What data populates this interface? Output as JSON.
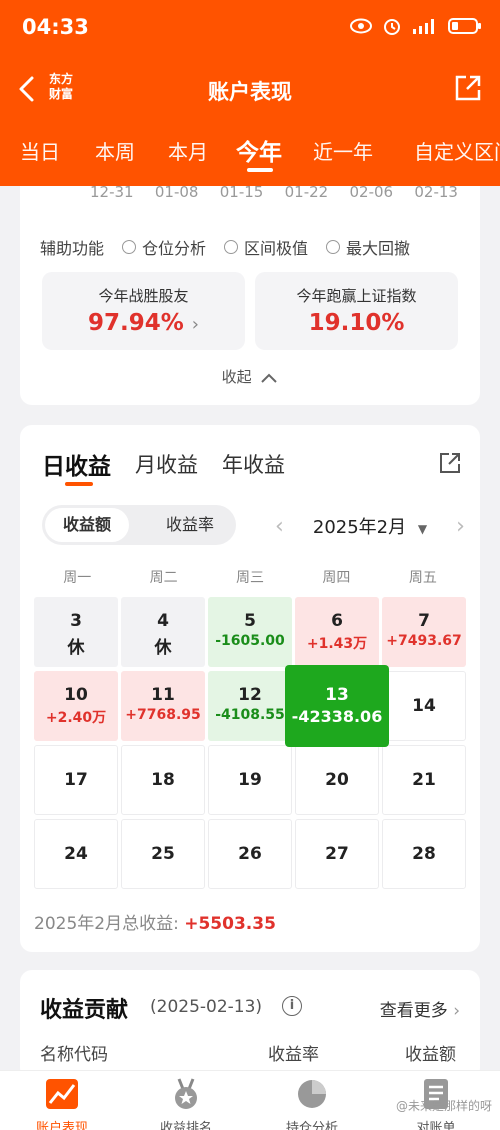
{
  "status": {
    "time": "04:33"
  },
  "header": {
    "logo": "东方\n财富",
    "title": "账户表现"
  },
  "period_tabs": [
    {
      "label": "当日",
      "active": false
    },
    {
      "label": "本周",
      "active": false
    },
    {
      "label": "本月",
      "active": false
    },
    {
      "label": "今年",
      "active": true
    },
    {
      "label": "近一年",
      "active": false
    },
    {
      "label": "自定义区间",
      "active": false
    }
  ],
  "chart_dates": [
    "12-31",
    "01-08",
    "01-15",
    "01-22",
    "02-06",
    "02-13"
  ],
  "aux": {
    "label": "辅助功能",
    "options": [
      "仓位分析",
      "区间极值",
      "最大回撤"
    ]
  },
  "stats": {
    "beat_label": "今年战胜股友",
    "beat_value": "97.94%",
    "index_label": "今年跑赢上证指数",
    "index_value": "19.10%"
  },
  "collapse_label": "收起",
  "profit": {
    "tabs": [
      "日收益",
      "月收益",
      "年收益"
    ],
    "segments": [
      "收益额",
      "收益率"
    ],
    "month": "2025年2月",
    "weekdays": [
      "周一",
      "周二",
      "周三",
      "周四",
      "周五"
    ],
    "days": [
      {
        "day": "3",
        "value": "休",
        "kind": "rest"
      },
      {
        "day": "4",
        "value": "休",
        "kind": "rest"
      },
      {
        "day": "5",
        "value": "-1605.00",
        "kind": "neg"
      },
      {
        "day": "6",
        "value": "+1.43万",
        "kind": "pos"
      },
      {
        "day": "7",
        "value": "+7493.67",
        "kind": "pos"
      },
      {
        "day": "10",
        "value": "+2.40万",
        "kind": "pos"
      },
      {
        "day": "11",
        "value": "+7768.95",
        "kind": "pos"
      },
      {
        "day": "12",
        "value": "-4108.55",
        "kind": "neg"
      },
      {
        "day": "13",
        "value": "-42338.06",
        "kind": "big"
      },
      {
        "day": "14",
        "value": "",
        "kind": "empty"
      },
      {
        "day": "17",
        "value": "",
        "kind": "empty"
      },
      {
        "day": "18",
        "value": "",
        "kind": "empty"
      },
      {
        "day": "19",
        "value": "",
        "kind": "empty"
      },
      {
        "day": "20",
        "value": "",
        "kind": "empty"
      },
      {
        "day": "21",
        "value": "",
        "kind": "empty"
      },
      {
        "day": "24",
        "value": "",
        "kind": "empty"
      },
      {
        "day": "25",
        "value": "",
        "kind": "empty"
      },
      {
        "day": "26",
        "value": "",
        "kind": "empty"
      },
      {
        "day": "27",
        "value": "",
        "kind": "empty"
      },
      {
        "day": "28",
        "value": "",
        "kind": "empty"
      }
    ],
    "total_label": "2025年2月总收益:",
    "total_value": "+5503.35"
  },
  "contribution": {
    "title": "收益贡献",
    "date": "(2025-02-13)",
    "more": "查看更多",
    "columns": [
      "名称代码",
      "收益率",
      "收益额"
    ]
  },
  "bottom_nav": [
    {
      "label": "账户表现",
      "icon": "chart-icon",
      "active": true
    },
    {
      "label": "收益排名",
      "icon": "medal-icon",
      "active": false
    },
    {
      "label": "持仓分析",
      "icon": "pie-icon",
      "active": false
    },
    {
      "label": "对账单",
      "icon": "document-icon",
      "active": false
    }
  ],
  "watermark": "@未来是那样的呀",
  "colors": {
    "brand": "#ff5300",
    "up": "#e0322c",
    "down": "#1a8d1a",
    "big_loss": "#1ea81e"
  }
}
